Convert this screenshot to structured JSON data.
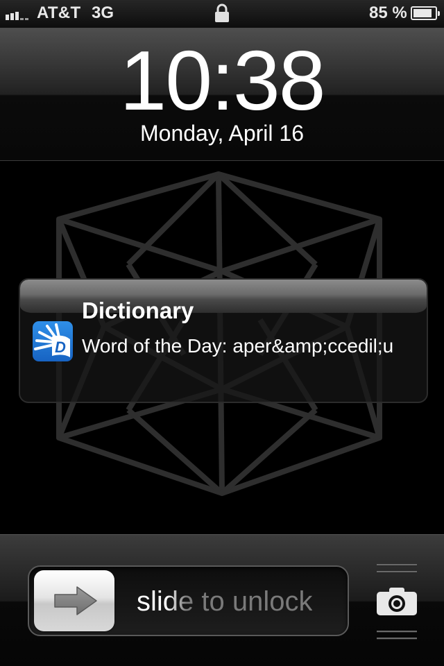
{
  "status_bar": {
    "carrier": "AT&T",
    "network": "3G",
    "signal_bars_filled": 3,
    "signal_bars_total": 5,
    "lock_icon": "padlock-icon",
    "battery_percent_text": "85 %",
    "battery_level": 0.85
  },
  "lock_screen": {
    "time": "10:38",
    "date": "Monday, April 16"
  },
  "notification": {
    "app_name": "Dictionary",
    "app_icon": "dictionary-app-icon",
    "message": "Word of the Day: aper&amp;ccedil;u"
  },
  "unlock_slider": {
    "label": "slide to unlock",
    "thumb_icon": "right-arrow-icon"
  },
  "camera": {
    "icon": "camera-icon"
  },
  "colors": {
    "app_icon_blue": "#1f74d6",
    "text_white": "#ffffff",
    "slider_text_gray": "#7a7a7a",
    "wallpaper_line": "#2e2e2e"
  }
}
